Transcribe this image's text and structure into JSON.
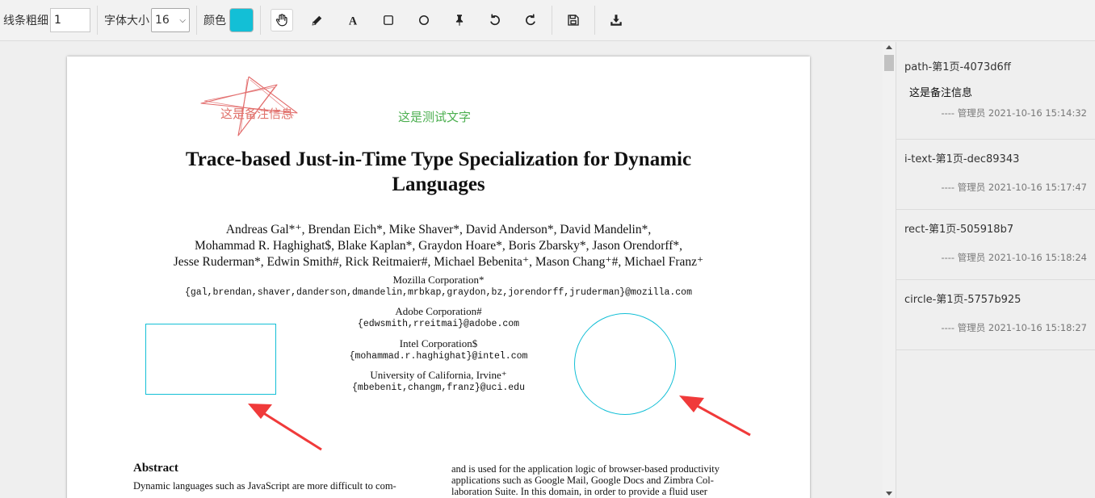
{
  "toolbar": {
    "line_width_label": "线条粗细",
    "line_width_value": "1",
    "font_size_label": "字体大小",
    "font_size_value": "16",
    "color_label": "颜色",
    "color_value": "#13bfd6",
    "tools": [
      "hand-icon",
      "pencil-icon",
      "text-icon",
      "rectangle-icon",
      "circle-icon",
      "pin-icon",
      "undo-icon",
      "redo-icon",
      "save-icon",
      "download-icon"
    ]
  },
  "annotations": {
    "star_text": "这是备注信息",
    "test_text": "这是测试文字",
    "star_color": "#e0716a",
    "test_text_color": "#4caf50",
    "shape_color": "#13bfd6",
    "arrow_color": "#f03a3a"
  },
  "paper": {
    "title_line1": "Trace-based Just-in-Time Type Specialization for Dynamic",
    "title_line2": "Languages",
    "authors_line1": "Andreas Gal*⁺, Brendan Eich*, Mike Shaver*, David Anderson*, David Mandelin*,",
    "authors_line2": "Mohammad R. Haghighat$, Blake Kaplan*, Graydon Hoare*, Boris Zbarsky*, Jason Orendorff*,",
    "authors_line3": "Jesse Ruderman*, Edwin Smith#, Rick Reitmaier#, Michael Bebenita⁺, Mason Chang⁺#, Michael Franz⁺",
    "affil1_org": "Mozilla Corporation*",
    "affil1_mail": "{gal,brendan,shaver,danderson,dmandelin,mrbkap,graydon,bz,jorendorff,jruderman}@mozilla.com",
    "affil2_org": "Adobe Corporation#",
    "affil2_mail": "{edwsmith,rreitmai}@adobe.com",
    "affil3_org": "Intel Corporation$",
    "affil3_mail": "{mohammad.r.haghighat}@intel.com",
    "affil4_org": "University of California, Irvine⁺",
    "affil4_mail": "{mbebenit,changm,franz}@uci.edu",
    "abstract_title": "Abstract",
    "abstract_text": "Dynamic languages such as JavaScript are more difficult to com-",
    "right_col_line1": "and is used for the application logic of browser-based productivity",
    "right_col_line2": "applications such as Google Mail, Google Docs and Zimbra Col-",
    "right_col_line3": "laboration Suite. In this domain, in order to provide a fluid user"
  },
  "notes": [
    {
      "id": "path-第1页-4073d6ff",
      "body": "这是备注信息",
      "meta": "---- 管理员 2021-10-16 15:14:32"
    },
    {
      "id": "i-text-第1页-dec89343",
      "body": "",
      "meta": "---- 管理员 2021-10-16 15:17:47"
    },
    {
      "id": "rect-第1页-505918b7",
      "body": "",
      "meta": "---- 管理员 2021-10-16 15:18:24"
    },
    {
      "id": "circle-第1页-5757b925",
      "body": "",
      "meta": "---- 管理员 2021-10-16 15:18:27"
    }
  ]
}
